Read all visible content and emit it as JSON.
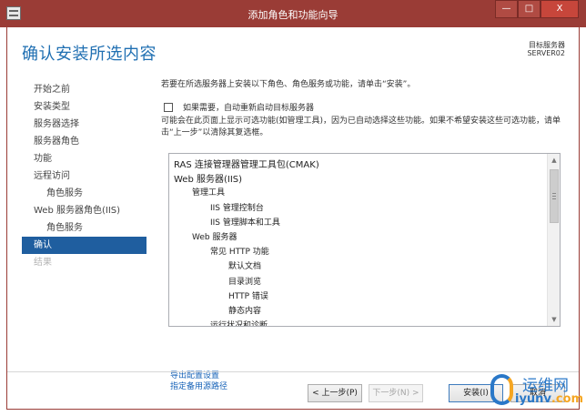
{
  "window": {
    "title": "添加角色和功能向导",
    "controls": [
      "—",
      "□",
      "X"
    ]
  },
  "header": {
    "title": "确认安装所选内容",
    "target_label": "目标服务器",
    "target_server": "SERVER02"
  },
  "sidebar": {
    "items": [
      {
        "label": "开始之前",
        "sub": false,
        "active": false,
        "disabled": false
      },
      {
        "label": "安装类型",
        "sub": false,
        "active": false,
        "disabled": false
      },
      {
        "label": "服务器选择",
        "sub": false,
        "active": false,
        "disabled": false
      },
      {
        "label": "服务器角色",
        "sub": false,
        "active": false,
        "disabled": false
      },
      {
        "label": "功能",
        "sub": false,
        "active": false,
        "disabled": false
      },
      {
        "label": "远程访问",
        "sub": false,
        "active": false,
        "disabled": false
      },
      {
        "label": "角色服务",
        "sub": true,
        "active": false,
        "disabled": false
      },
      {
        "label": "Web 服务器角色(IIS)",
        "sub": false,
        "active": false,
        "disabled": false
      },
      {
        "label": "角色服务",
        "sub": true,
        "active": false,
        "disabled": false
      },
      {
        "label": "确认",
        "sub": false,
        "active": true,
        "disabled": false
      },
      {
        "label": "结果",
        "sub": false,
        "active": false,
        "disabled": true
      }
    ]
  },
  "content": {
    "intro": "若要在所选服务器上安装以下角色、角色服务或功能，请单击“安装”。",
    "restart_checkbox_label": "如果需要，自动重新启动目标服务器",
    "restart_checked": false,
    "note": "可能会在此页面上显示可选功能(如管理工具)，因为已自动选择这些功能。如果不希望安装这些可选功能，请单击“上一步”以清除其复选框。",
    "features": [
      {
        "label": "RAS 连接管理器管理工具包(CMAK)",
        "level": 0
      },
      {
        "label": "Web 服务器(IIS)",
        "level": 0
      },
      {
        "label": "管理工具",
        "level": 1
      },
      {
        "label": "IIS 管理控制台",
        "level": 2
      },
      {
        "label": "IIS 管理脚本和工具",
        "level": 2
      },
      {
        "label": "Web 服务器",
        "level": 1
      },
      {
        "label": "常见 HTTP 功能",
        "level": 2
      },
      {
        "label": "默认文档",
        "level": 3
      },
      {
        "label": "目录浏览",
        "level": 3
      },
      {
        "label": "HTTP 错误",
        "level": 3
      },
      {
        "label": "静态内容",
        "level": 3
      },
      {
        "label": "运行状况和诊断",
        "level": 2
      }
    ],
    "links": {
      "export": "导出配置设置",
      "alt_source": "指定备用源路径"
    }
  },
  "buttons": {
    "previous": "< 上一步(P)",
    "next": "下一步(N) >",
    "install": "安装(I)",
    "cancel": "取消"
  },
  "watermark": {
    "text1": "运维网",
    "text2_a": "iyunv",
    "text2_b": ".com"
  }
}
